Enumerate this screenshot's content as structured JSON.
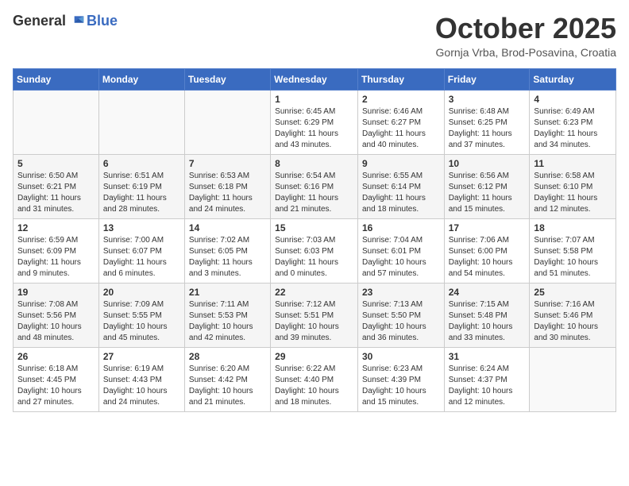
{
  "header": {
    "logo_general": "General",
    "logo_blue": "Blue",
    "title": "October 2025",
    "subtitle": "Gornja Vrba, Brod-Posavina, Croatia"
  },
  "days_of_week": [
    "Sunday",
    "Monday",
    "Tuesday",
    "Wednesday",
    "Thursday",
    "Friday",
    "Saturday"
  ],
  "weeks": [
    [
      {
        "day": "",
        "info": ""
      },
      {
        "day": "",
        "info": ""
      },
      {
        "day": "",
        "info": ""
      },
      {
        "day": "1",
        "info": "Sunrise: 6:45 AM\nSunset: 6:29 PM\nDaylight: 11 hours\nand 43 minutes."
      },
      {
        "day": "2",
        "info": "Sunrise: 6:46 AM\nSunset: 6:27 PM\nDaylight: 11 hours\nand 40 minutes."
      },
      {
        "day": "3",
        "info": "Sunrise: 6:48 AM\nSunset: 6:25 PM\nDaylight: 11 hours\nand 37 minutes."
      },
      {
        "day": "4",
        "info": "Sunrise: 6:49 AM\nSunset: 6:23 PM\nDaylight: 11 hours\nand 34 minutes."
      }
    ],
    [
      {
        "day": "5",
        "info": "Sunrise: 6:50 AM\nSunset: 6:21 PM\nDaylight: 11 hours\nand 31 minutes."
      },
      {
        "day": "6",
        "info": "Sunrise: 6:51 AM\nSunset: 6:19 PM\nDaylight: 11 hours\nand 28 minutes."
      },
      {
        "day": "7",
        "info": "Sunrise: 6:53 AM\nSunset: 6:18 PM\nDaylight: 11 hours\nand 24 minutes."
      },
      {
        "day": "8",
        "info": "Sunrise: 6:54 AM\nSunset: 6:16 PM\nDaylight: 11 hours\nand 21 minutes."
      },
      {
        "day": "9",
        "info": "Sunrise: 6:55 AM\nSunset: 6:14 PM\nDaylight: 11 hours\nand 18 minutes."
      },
      {
        "day": "10",
        "info": "Sunrise: 6:56 AM\nSunset: 6:12 PM\nDaylight: 11 hours\nand 15 minutes."
      },
      {
        "day": "11",
        "info": "Sunrise: 6:58 AM\nSunset: 6:10 PM\nDaylight: 11 hours\nand 12 minutes."
      }
    ],
    [
      {
        "day": "12",
        "info": "Sunrise: 6:59 AM\nSunset: 6:09 PM\nDaylight: 11 hours\nand 9 minutes."
      },
      {
        "day": "13",
        "info": "Sunrise: 7:00 AM\nSunset: 6:07 PM\nDaylight: 11 hours\nand 6 minutes."
      },
      {
        "day": "14",
        "info": "Sunrise: 7:02 AM\nSunset: 6:05 PM\nDaylight: 11 hours\nand 3 minutes."
      },
      {
        "day": "15",
        "info": "Sunrise: 7:03 AM\nSunset: 6:03 PM\nDaylight: 11 hours\nand 0 minutes."
      },
      {
        "day": "16",
        "info": "Sunrise: 7:04 AM\nSunset: 6:01 PM\nDaylight: 10 hours\nand 57 minutes."
      },
      {
        "day": "17",
        "info": "Sunrise: 7:06 AM\nSunset: 6:00 PM\nDaylight: 10 hours\nand 54 minutes."
      },
      {
        "day": "18",
        "info": "Sunrise: 7:07 AM\nSunset: 5:58 PM\nDaylight: 10 hours\nand 51 minutes."
      }
    ],
    [
      {
        "day": "19",
        "info": "Sunrise: 7:08 AM\nSunset: 5:56 PM\nDaylight: 10 hours\nand 48 minutes."
      },
      {
        "day": "20",
        "info": "Sunrise: 7:09 AM\nSunset: 5:55 PM\nDaylight: 10 hours\nand 45 minutes."
      },
      {
        "day": "21",
        "info": "Sunrise: 7:11 AM\nSunset: 5:53 PM\nDaylight: 10 hours\nand 42 minutes."
      },
      {
        "day": "22",
        "info": "Sunrise: 7:12 AM\nSunset: 5:51 PM\nDaylight: 10 hours\nand 39 minutes."
      },
      {
        "day": "23",
        "info": "Sunrise: 7:13 AM\nSunset: 5:50 PM\nDaylight: 10 hours\nand 36 minutes."
      },
      {
        "day": "24",
        "info": "Sunrise: 7:15 AM\nSunset: 5:48 PM\nDaylight: 10 hours\nand 33 minutes."
      },
      {
        "day": "25",
        "info": "Sunrise: 7:16 AM\nSunset: 5:46 PM\nDaylight: 10 hours\nand 30 minutes."
      }
    ],
    [
      {
        "day": "26",
        "info": "Sunrise: 6:18 AM\nSunset: 4:45 PM\nDaylight: 10 hours\nand 27 minutes."
      },
      {
        "day": "27",
        "info": "Sunrise: 6:19 AM\nSunset: 4:43 PM\nDaylight: 10 hours\nand 24 minutes."
      },
      {
        "day": "28",
        "info": "Sunrise: 6:20 AM\nSunset: 4:42 PM\nDaylight: 10 hours\nand 21 minutes."
      },
      {
        "day": "29",
        "info": "Sunrise: 6:22 AM\nSunset: 4:40 PM\nDaylight: 10 hours\nand 18 minutes."
      },
      {
        "day": "30",
        "info": "Sunrise: 6:23 AM\nSunset: 4:39 PM\nDaylight: 10 hours\nand 15 minutes."
      },
      {
        "day": "31",
        "info": "Sunrise: 6:24 AM\nSunset: 4:37 PM\nDaylight: 10 hours\nand 12 minutes."
      },
      {
        "day": "",
        "info": ""
      }
    ]
  ]
}
